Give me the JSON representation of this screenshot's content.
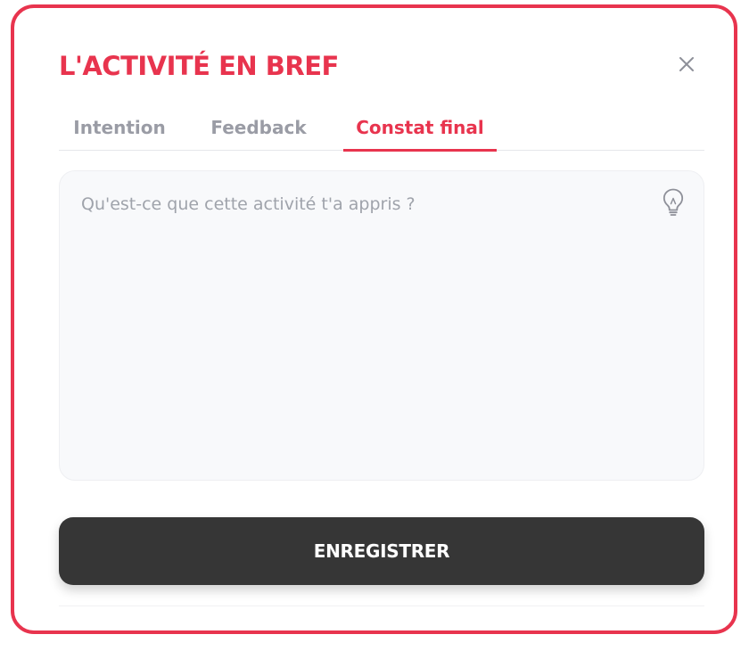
{
  "modal": {
    "title": "L'ACTIVITÉ EN BREF",
    "close_icon": "close-icon"
  },
  "tabs": [
    {
      "label": "Intention",
      "active": false
    },
    {
      "label": "Feedback",
      "active": false
    },
    {
      "label": "Constat final",
      "active": true
    }
  ],
  "editor": {
    "value": "",
    "placeholder": "Qu'est-ce que cette activité t'a appris ?",
    "hint_icon": "lightbulb-icon"
  },
  "actions": {
    "save_label": "ENREGISTRER"
  },
  "colors": {
    "accent": "#e8344e",
    "inactive_tab": "#9a9ca5",
    "button_bg": "#363636",
    "textarea_bg": "#f8f9fb"
  }
}
